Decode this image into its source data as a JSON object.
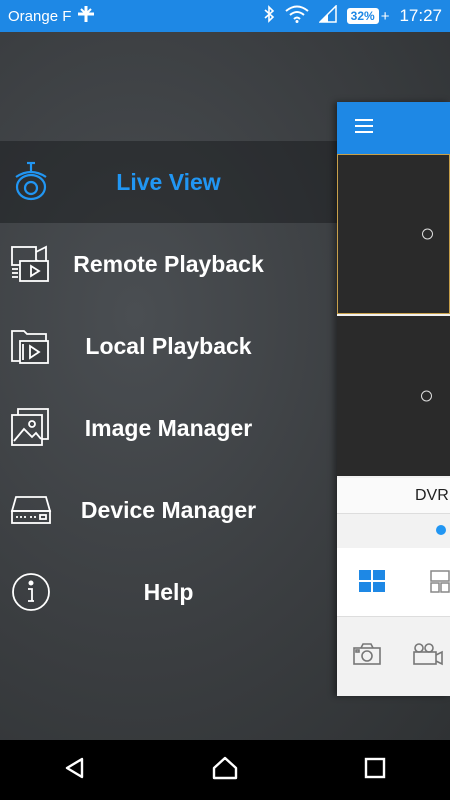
{
  "status_bar": {
    "carrier": "Orange F",
    "battery": "32%",
    "battery_plus": "+",
    "time": "17:27"
  },
  "menu": {
    "items": [
      {
        "label": "Live View",
        "icon": "camera-icon",
        "active": true
      },
      {
        "label": "Remote Playback",
        "icon": "remote-playback-icon",
        "active": false
      },
      {
        "label": "Local Playback",
        "icon": "local-playback-icon",
        "active": false
      },
      {
        "label": "Image Manager",
        "icon": "image-icon",
        "active": false
      },
      {
        "label": "Device Manager",
        "icon": "dvr-device-icon",
        "active": false
      },
      {
        "label": "Help",
        "icon": "info-icon",
        "active": false
      }
    ]
  },
  "main_panel": {
    "device_label": "DVR"
  },
  "colors": {
    "accent": "#1e88e5",
    "active_text": "#2196f3"
  }
}
